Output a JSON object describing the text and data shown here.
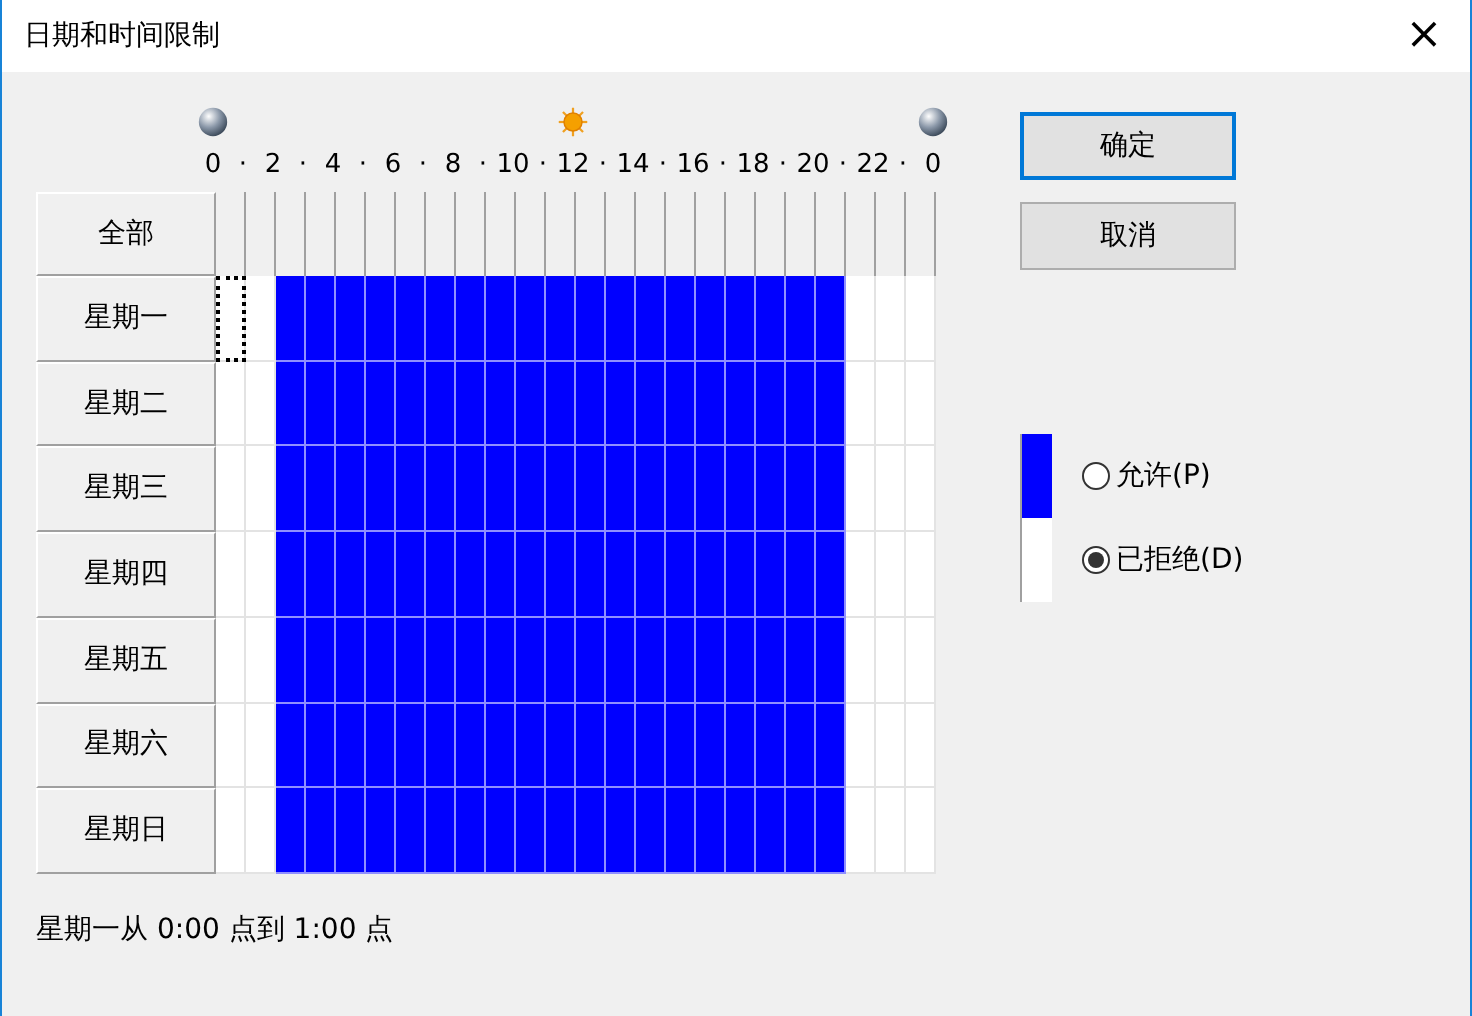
{
  "window": {
    "title": "日期和时间限制",
    "close": "×"
  },
  "hour_ticks": [
    "0",
    "·",
    "2",
    "·",
    "4",
    "·",
    "6",
    "·",
    "8",
    "·",
    "10",
    "·",
    "12",
    "·",
    "14",
    "·",
    "16",
    "·",
    "18",
    "·",
    "20",
    "·",
    "22",
    "·",
    "0"
  ],
  "grid": {
    "all_label": "全部",
    "days": [
      {
        "label": "星期一",
        "cells": [
          {
            "allowed": false,
            "focused": true
          },
          {
            "allowed": false,
            "focused": false
          },
          {
            "allowed": true,
            "focused": false
          },
          {
            "allowed": true,
            "focused": false
          },
          {
            "allowed": true,
            "focused": false
          },
          {
            "allowed": true,
            "focused": false
          },
          {
            "allowed": true,
            "focused": false
          },
          {
            "allowed": true,
            "focused": false
          },
          {
            "allowed": true,
            "focused": false
          },
          {
            "allowed": true,
            "focused": false
          },
          {
            "allowed": true,
            "focused": false
          },
          {
            "allowed": true,
            "focused": false
          },
          {
            "allowed": true,
            "focused": false
          },
          {
            "allowed": true,
            "focused": false
          },
          {
            "allowed": true,
            "focused": false
          },
          {
            "allowed": true,
            "focused": false
          },
          {
            "allowed": true,
            "focused": false
          },
          {
            "allowed": true,
            "focused": false
          },
          {
            "allowed": true,
            "focused": false
          },
          {
            "allowed": true,
            "focused": false
          },
          {
            "allowed": true,
            "focused": false
          },
          {
            "allowed": false,
            "focused": false
          },
          {
            "allowed": false,
            "focused": false
          },
          {
            "allowed": false,
            "focused": false
          }
        ]
      },
      {
        "label": "星期二",
        "cells": [
          {
            "allowed": false,
            "focused": false
          },
          {
            "allowed": false,
            "focused": false
          },
          {
            "allowed": true,
            "focused": false
          },
          {
            "allowed": true,
            "focused": false
          },
          {
            "allowed": true,
            "focused": false
          },
          {
            "allowed": true,
            "focused": false
          },
          {
            "allowed": true,
            "focused": false
          },
          {
            "allowed": true,
            "focused": false
          },
          {
            "allowed": true,
            "focused": false
          },
          {
            "allowed": true,
            "focused": false
          },
          {
            "allowed": true,
            "focused": false
          },
          {
            "allowed": true,
            "focused": false
          },
          {
            "allowed": true,
            "focused": false
          },
          {
            "allowed": true,
            "focused": false
          },
          {
            "allowed": true,
            "focused": false
          },
          {
            "allowed": true,
            "focused": false
          },
          {
            "allowed": true,
            "focused": false
          },
          {
            "allowed": true,
            "focused": false
          },
          {
            "allowed": true,
            "focused": false
          },
          {
            "allowed": true,
            "focused": false
          },
          {
            "allowed": true,
            "focused": false
          },
          {
            "allowed": false,
            "focused": false
          },
          {
            "allowed": false,
            "focused": false
          },
          {
            "allowed": false,
            "focused": false
          }
        ]
      },
      {
        "label": "星期三",
        "cells": [
          {
            "allowed": false,
            "focused": false
          },
          {
            "allowed": false,
            "focused": false
          },
          {
            "allowed": true,
            "focused": false
          },
          {
            "allowed": true,
            "focused": false
          },
          {
            "allowed": true,
            "focused": false
          },
          {
            "allowed": true,
            "focused": false
          },
          {
            "allowed": true,
            "focused": false
          },
          {
            "allowed": true,
            "focused": false
          },
          {
            "allowed": true,
            "focused": false
          },
          {
            "allowed": true,
            "focused": false
          },
          {
            "allowed": true,
            "focused": false
          },
          {
            "allowed": true,
            "focused": false
          },
          {
            "allowed": true,
            "focused": false
          },
          {
            "allowed": true,
            "focused": false
          },
          {
            "allowed": true,
            "focused": false
          },
          {
            "allowed": true,
            "focused": false
          },
          {
            "allowed": true,
            "focused": false
          },
          {
            "allowed": true,
            "focused": false
          },
          {
            "allowed": true,
            "focused": false
          },
          {
            "allowed": true,
            "focused": false
          },
          {
            "allowed": true,
            "focused": false
          },
          {
            "allowed": false,
            "focused": false
          },
          {
            "allowed": false,
            "focused": false
          },
          {
            "allowed": false,
            "focused": false
          }
        ]
      },
      {
        "label": "星期四",
        "cells": [
          {
            "allowed": false,
            "focused": false
          },
          {
            "allowed": false,
            "focused": false
          },
          {
            "allowed": true,
            "focused": false
          },
          {
            "allowed": true,
            "focused": false
          },
          {
            "allowed": true,
            "focused": false
          },
          {
            "allowed": true,
            "focused": false
          },
          {
            "allowed": true,
            "focused": false
          },
          {
            "allowed": true,
            "focused": false
          },
          {
            "allowed": true,
            "focused": false
          },
          {
            "allowed": true,
            "focused": false
          },
          {
            "allowed": true,
            "focused": false
          },
          {
            "allowed": true,
            "focused": false
          },
          {
            "allowed": true,
            "focused": false
          },
          {
            "allowed": true,
            "focused": false
          },
          {
            "allowed": true,
            "focused": false
          },
          {
            "allowed": true,
            "focused": false
          },
          {
            "allowed": true,
            "focused": false
          },
          {
            "allowed": true,
            "focused": false
          },
          {
            "allowed": true,
            "focused": false
          },
          {
            "allowed": true,
            "focused": false
          },
          {
            "allowed": true,
            "focused": false
          },
          {
            "allowed": false,
            "focused": false
          },
          {
            "allowed": false,
            "focused": false
          },
          {
            "allowed": false,
            "focused": false
          }
        ]
      },
      {
        "label": "星期五",
        "cells": [
          {
            "allowed": false,
            "focused": false
          },
          {
            "allowed": false,
            "focused": false
          },
          {
            "allowed": true,
            "focused": false
          },
          {
            "allowed": true,
            "focused": false
          },
          {
            "allowed": true,
            "focused": false
          },
          {
            "allowed": true,
            "focused": false
          },
          {
            "allowed": true,
            "focused": false
          },
          {
            "allowed": true,
            "focused": false
          },
          {
            "allowed": true,
            "focused": false
          },
          {
            "allowed": true,
            "focused": false
          },
          {
            "allowed": true,
            "focused": false
          },
          {
            "allowed": true,
            "focused": false
          },
          {
            "allowed": true,
            "focused": false
          },
          {
            "allowed": true,
            "focused": false
          },
          {
            "allowed": true,
            "focused": false
          },
          {
            "allowed": true,
            "focused": false
          },
          {
            "allowed": true,
            "focused": false
          },
          {
            "allowed": true,
            "focused": false
          },
          {
            "allowed": true,
            "focused": false
          },
          {
            "allowed": true,
            "focused": false
          },
          {
            "allowed": true,
            "focused": false
          },
          {
            "allowed": false,
            "focused": false
          },
          {
            "allowed": false,
            "focused": false
          },
          {
            "allowed": false,
            "focused": false
          }
        ]
      },
      {
        "label": "星期六",
        "cells": [
          {
            "allowed": false,
            "focused": false
          },
          {
            "allowed": false,
            "focused": false
          },
          {
            "allowed": true,
            "focused": false
          },
          {
            "allowed": true,
            "focused": false
          },
          {
            "allowed": true,
            "focused": false
          },
          {
            "allowed": true,
            "focused": false
          },
          {
            "allowed": true,
            "focused": false
          },
          {
            "allowed": true,
            "focused": false
          },
          {
            "allowed": true,
            "focused": false
          },
          {
            "allowed": true,
            "focused": false
          },
          {
            "allowed": true,
            "focused": false
          },
          {
            "allowed": true,
            "focused": false
          },
          {
            "allowed": true,
            "focused": false
          },
          {
            "allowed": true,
            "focused": false
          },
          {
            "allowed": true,
            "focused": false
          },
          {
            "allowed": true,
            "focused": false
          },
          {
            "allowed": true,
            "focused": false
          },
          {
            "allowed": true,
            "focused": false
          },
          {
            "allowed": true,
            "focused": false
          },
          {
            "allowed": true,
            "focused": false
          },
          {
            "allowed": true,
            "focused": false
          },
          {
            "allowed": false,
            "focused": false
          },
          {
            "allowed": false,
            "focused": false
          },
          {
            "allowed": false,
            "focused": false
          }
        ]
      },
      {
        "label": "星期日",
        "cells": [
          {
            "allowed": false,
            "focused": false
          },
          {
            "allowed": false,
            "focused": false
          },
          {
            "allowed": true,
            "focused": false
          },
          {
            "allowed": true,
            "focused": false
          },
          {
            "allowed": true,
            "focused": false
          },
          {
            "allowed": true,
            "focused": false
          },
          {
            "allowed": true,
            "focused": false
          },
          {
            "allowed": true,
            "focused": false
          },
          {
            "allowed": true,
            "focused": false
          },
          {
            "allowed": true,
            "focused": false
          },
          {
            "allowed": true,
            "focused": false
          },
          {
            "allowed": true,
            "focused": false
          },
          {
            "allowed": true,
            "focused": false
          },
          {
            "allowed": true,
            "focused": false
          },
          {
            "allowed": true,
            "focused": false
          },
          {
            "allowed": true,
            "focused": false
          },
          {
            "allowed": true,
            "focused": false
          },
          {
            "allowed": true,
            "focused": false
          },
          {
            "allowed": true,
            "focused": false
          },
          {
            "allowed": true,
            "focused": false
          },
          {
            "allowed": true,
            "focused": false
          },
          {
            "allowed": false,
            "focused": false
          },
          {
            "allowed": false,
            "focused": false
          },
          {
            "allowed": false,
            "focused": false
          }
        ]
      }
    ]
  },
  "buttons": [
    {
      "label": "确定",
      "default": true
    },
    {
      "label": "取消",
      "default": false
    }
  ],
  "legend": [
    {
      "label": "允许(P)",
      "selected": false,
      "color": "#0000ff"
    },
    {
      "label": "已拒绝(D)",
      "selected": true,
      "color": "#ffffff"
    }
  ],
  "status": "星期一从 0:00 点到 1:00 点"
}
